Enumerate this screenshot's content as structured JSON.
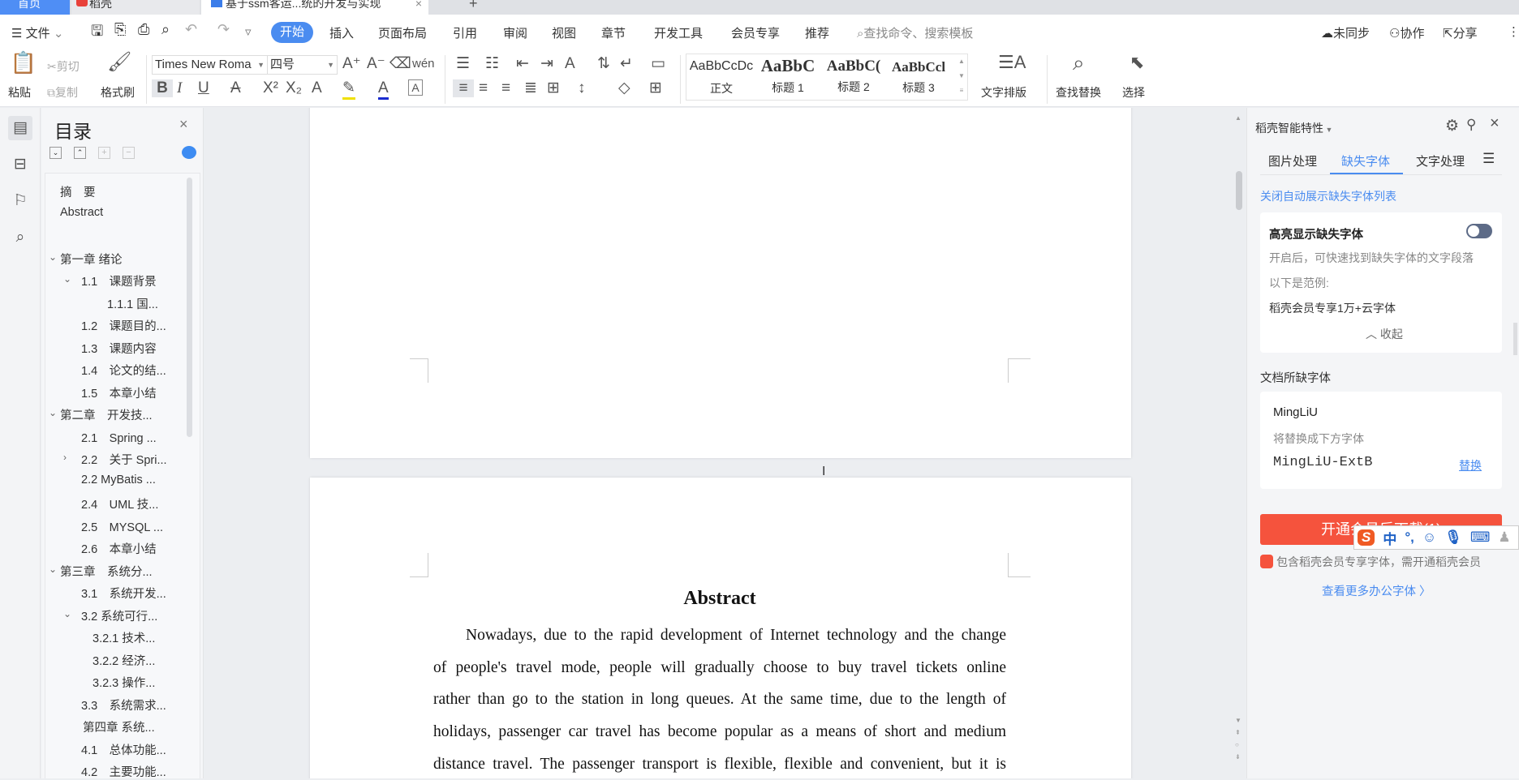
{
  "tabs": [
    {
      "label": "首页"
    },
    {
      "label": "稻壳"
    },
    {
      "label": "基于ssm客运...统的开发与实现"
    }
  ],
  "menu": {
    "file": "文件",
    "items": [
      "开始",
      "插入",
      "页面布局",
      "引用",
      "审阅",
      "视图",
      "章节",
      "开发工具",
      "会员专享",
      "推荐"
    ],
    "search_placeholder": "查找命令、搜索模板",
    "sync": "未同步",
    "collab": "协作",
    "share": "分享"
  },
  "ribbon": {
    "paste": "粘贴",
    "cut": "剪切",
    "copy": "复制",
    "format_painter": "格式刷",
    "font_name": "Times New Roma",
    "font_size": "四号",
    "styles": [
      {
        "preview": "AaBbCcDc",
        "label": "正文"
      },
      {
        "preview": "AaBbC",
        "label": "标题 1"
      },
      {
        "preview": "AaBbC(",
        "label": "标题 2"
      },
      {
        "preview": "AaBbCcl",
        "label": "标题 3"
      }
    ],
    "text_layout": "文字排版",
    "find_replace": "查找替换",
    "select": "选择"
  },
  "toc": {
    "title": "目录",
    "items": [
      {
        "label": "摘　要",
        "level": 1
      },
      {
        "label": "Abstract",
        "level": 1
      },
      {
        "label": "",
        "level": 1
      },
      {
        "label": "第一章 绪论",
        "level": 1,
        "arrow": "down"
      },
      {
        "label": "1.1　课题背景",
        "level": 2,
        "arrow": "down"
      },
      {
        "label": "1.1.1 国...",
        "level": 4
      },
      {
        "label": "1.2　课题目的...",
        "level": 2
      },
      {
        "label": "1.3　课题内容",
        "level": 2
      },
      {
        "label": "1.4　论文的结...",
        "level": 2
      },
      {
        "label": "1.5　本章小结",
        "level": 2
      },
      {
        "label": "第二章　开发技...",
        "level": 1,
        "arrow": "down"
      },
      {
        "label": "2.1　Spring ...",
        "level": 2
      },
      {
        "label": "2.2　关于 Spri...",
        "level": 2,
        "arrow": "right"
      },
      {
        "label": "2.2 MyBatis ...",
        "level": 2
      },
      {
        "label": "2.4　UML 技...",
        "level": 2
      },
      {
        "label": "2.5　MYSQL ...",
        "level": 2
      },
      {
        "label": "2.6　本章小结",
        "level": 2
      },
      {
        "label": "第三章　系统分...",
        "level": 1,
        "arrow": "down"
      },
      {
        "label": "3.1　系统开发...",
        "level": 2
      },
      {
        "label": "3.2 系统可行...",
        "level": 2,
        "arrow": "down"
      },
      {
        "label": "3.2.1 技术...",
        "level": 3
      },
      {
        "label": "3.2.2 经济...",
        "level": 3
      },
      {
        "label": "3.2.3 操作...",
        "level": 3
      },
      {
        "label": "3.3　系统需求...",
        "level": 2
      },
      {
        "label": "第四章 系统...",
        "level": 5
      },
      {
        "label": "4.1　总体功能...",
        "level": 2
      },
      {
        "label": "4.2　主要功能...",
        "level": 2
      }
    ]
  },
  "document": {
    "abstract_title": "Abstract",
    "lines": [
      "Nowadays, due to the rapid development of Internet technology and the change",
      "of people's travel mode, people will gradually choose to buy travel tickets online",
      "rather than go to the station in long queues. At the same time, due to the length of",
      "holidays, passenger car travel has become popular as a means of short and medium",
      "distance travel. The passenger transport is flexible, flexible and convenient, but it is"
    ]
  },
  "panel": {
    "title": "稻壳智能特性",
    "tabs": [
      "图片处理",
      "缺失字体",
      "文字处理"
    ],
    "active_tab": 1,
    "close_auto_link": "关闭自动展示缺失字体列表",
    "highlight_title": "高亮显示缺失字体",
    "highlight_on": false,
    "highlight_desc": "开启后，可快速找到缺失字体的文字段落",
    "example_label": "以下是范例:",
    "example_text": "稻壳会员专享1万+云字体",
    "collapse": "收起",
    "missing_title": "文档所缺字体",
    "missing_font": "MingLiU",
    "replace_hint": "将替换成下方字体",
    "replacement_font": "MingLiU-ExtB",
    "replace_link": "替换",
    "download_button": "开通会员后下载(1)",
    "member_note": "包含稻壳会员专享字体，需开通稻壳会员",
    "more_fonts": "查看更多办公字体 〉"
  },
  "ime": {
    "lang": "中",
    "punct": "°,"
  },
  "colors": {
    "accent": "#4a8cf0",
    "red": "#f5533d"
  }
}
